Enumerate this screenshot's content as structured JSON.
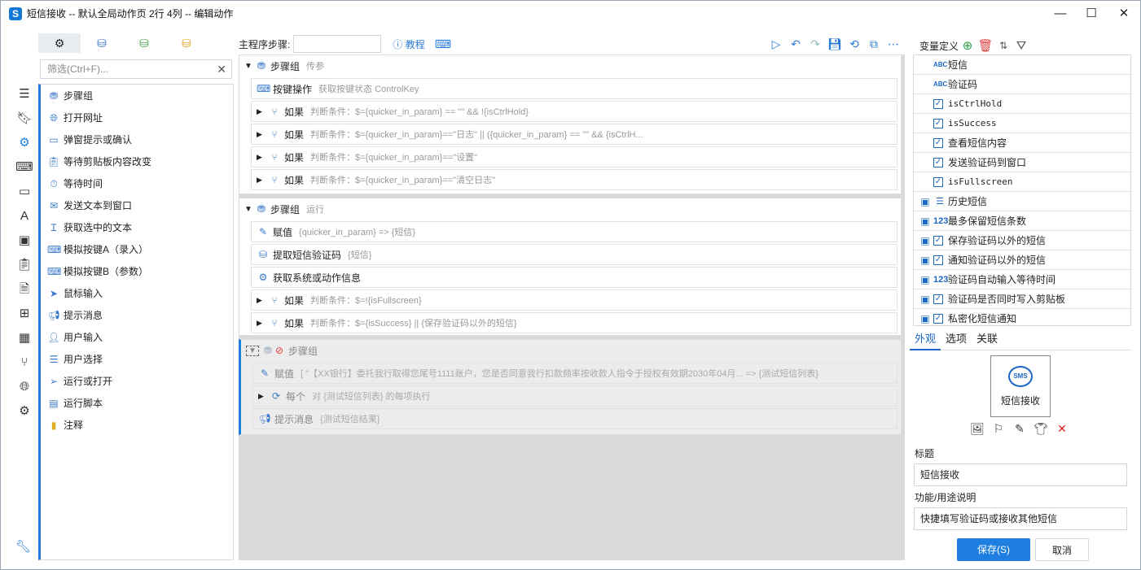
{
  "window": {
    "title": "短信接收 -- 默认全局动作页 2行 4列 -- 编辑动作",
    "app_icon": "S"
  },
  "left": {
    "filter_placeholder": "筛选(Ctrl+F)...",
    "modules": [
      {
        "label": "步骤组",
        "icon": "layers-icon"
      },
      {
        "label": "打开网址",
        "icon": "globe-icon"
      },
      {
        "label": "弹窗提示或确认",
        "icon": "dialog-icon"
      },
      {
        "label": "等待剪贴板内容改变",
        "icon": "clipboard-check-icon"
      },
      {
        "label": "等待时间",
        "icon": "timer-icon"
      },
      {
        "label": "发送文本到窗口",
        "icon": "message-icon"
      },
      {
        "label": "获取选中的文本",
        "icon": "text-cursor-icon"
      },
      {
        "label": "模拟按键A（录入）",
        "icon": "keyboard-icon"
      },
      {
        "label": "模拟按键B（参数）",
        "icon": "keyboard-icon"
      },
      {
        "label": "鼠标输入",
        "icon": "cursor-icon"
      },
      {
        "label": "提示消息",
        "icon": "megaphone-icon"
      },
      {
        "label": "用户输入",
        "icon": "user-edit-icon"
      },
      {
        "label": "用户选择",
        "icon": "list-select-icon"
      },
      {
        "label": "运行或打开",
        "icon": "send-icon"
      },
      {
        "label": "运行脚本",
        "icon": "script-icon"
      },
      {
        "label": "注释",
        "icon": "note-icon"
      }
    ]
  },
  "center": {
    "prog_label": "主程序步骤:",
    "tutorial": "教程",
    "group1": {
      "name": "步骤组",
      "desc": "传参",
      "rows": [
        {
          "name": "按键操作",
          "desc": "获取按键状态 ControlKey",
          "icon": "keyboard-icon"
        },
        {
          "name": "如果",
          "desc": "判断条件：$={quicker_in_param} == \"\" && !{isCtrlHold}",
          "icon": "branch-icon"
        },
        {
          "name": "如果",
          "desc": "判断条件：$={quicker_in_param}==\"日志\" || ({quicker_in_param} == \"\" && {isCtrlH...",
          "icon": "branch-icon"
        },
        {
          "name": "如果",
          "desc": "判断条件：$={quicker_in_param}==\"设置\"",
          "icon": "branch-icon"
        },
        {
          "name": "如果",
          "desc": "判断条件：$={quicker_in_param}==\"清空日志\"",
          "icon": "branch-icon"
        }
      ]
    },
    "group2": {
      "name": "步骤组",
      "desc": "运行",
      "rows": [
        {
          "name": "赋值",
          "desc": "{quicker_in_param} => {短信}",
          "icon": "edit-icon"
        },
        {
          "name": "提取短信验证码",
          "desc": "{短信}",
          "icon": "cubes-icon"
        },
        {
          "name": "获取系统或动作信息",
          "desc": "",
          "icon": "gear-icon"
        },
        {
          "name": "如果",
          "desc": "判断条件：$=!{isFullscreen}",
          "icon": "branch-icon"
        },
        {
          "name": "如果",
          "desc": "判断条件：$={isSuccess} || {保存验证码以外的短信}",
          "icon": "branch-icon"
        }
      ]
    },
    "group3": {
      "name": "步骤组",
      "desc": "",
      "rows": [
        {
          "name": "赋值",
          "desc": "[ \"【XX银行】委托我行取得您尾号1111账户，您是否同意我行扣款频率按收款人指令于授权有效期2030年04月... => {测试短信列表}",
          "icon": "edit-icon"
        },
        {
          "name": "每个",
          "desc": "对 {测试短信列表} 的每项执行",
          "icon": "loop-icon"
        },
        {
          "name": "提示消息",
          "desc": "{测试短信结果}",
          "icon": "megaphone-icon"
        }
      ]
    }
  },
  "right": {
    "vars_title": "变量定义",
    "variables": [
      {
        "name": "短信",
        "type": "ABC",
        "checked": false,
        "saved": false,
        "mono": false
      },
      {
        "name": "验证码",
        "type": "ABC",
        "checked": false,
        "saved": false,
        "mono": false
      },
      {
        "name": "isCtrlHold",
        "type": "bool",
        "checked": true,
        "saved": false,
        "mono": true
      },
      {
        "name": "isSuccess",
        "type": "bool",
        "checked": true,
        "saved": false,
        "mono": true
      },
      {
        "name": "查看短信内容",
        "type": "bool",
        "checked": true,
        "saved": false,
        "mono": false
      },
      {
        "name": "发送验证码到窗口",
        "type": "bool",
        "checked": true,
        "saved": false,
        "mono": false
      },
      {
        "name": "isFullscreen",
        "type": "bool",
        "checked": true,
        "saved": false,
        "mono": true
      },
      {
        "name": "历史短信",
        "type": "list",
        "checked": false,
        "saved": true,
        "mono": false
      },
      {
        "name": "最多保留短信条数",
        "type": "123",
        "checked": false,
        "saved": true,
        "mono": false
      },
      {
        "name": "保存验证码以外的短信",
        "type": "bool",
        "checked": true,
        "saved": true,
        "mono": false
      },
      {
        "name": "通知验证码以外的短信",
        "type": "bool",
        "checked": true,
        "saved": true,
        "mono": false
      },
      {
        "name": "验证码自动输入等待时间",
        "type": "123",
        "checked": false,
        "saved": true,
        "mono": false
      },
      {
        "name": "验证码是否同时写入剪贴板",
        "type": "bool",
        "checked": true,
        "saved": true,
        "mono": false
      },
      {
        "name": "私密化短信通知",
        "type": "bool",
        "checked": true,
        "saved": true,
        "mono": false
      }
    ],
    "tabs": [
      "外观",
      "选项",
      "关联"
    ],
    "icon_label": "短信接收",
    "icon_badge": "SMS",
    "title_label": "标题",
    "title_value": "短信接收",
    "desc_label": "功能/用途说明",
    "desc_value": "快捷填写验证码或接收其他短信",
    "save_label": "保存(S)",
    "cancel_label": "取消"
  },
  "colors": {
    "accent": "#1f7fe0",
    "icon_blue": "#3a78c8"
  }
}
